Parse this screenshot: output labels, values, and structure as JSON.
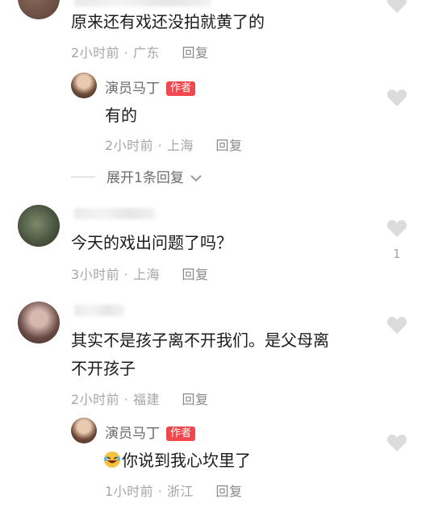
{
  "comments": [
    {
      "text": "原来还有戏还没拍就黄了的",
      "time": "2小时前 · 广东",
      "reply_label": "回复"
    },
    {
      "text": "今天的戏出问题了吗？",
      "time": "3小时前 · 上海",
      "reply_label": "回复",
      "like_count": "1"
    },
    {
      "text_line1": "其实不是孩子离不开我们。是父母离",
      "text_line2": "不开孩子",
      "time": "2小时前 · 福建",
      "reply_label": "回复"
    }
  ],
  "replies": [
    {
      "author": "演员马丁",
      "badge": "作者",
      "text": "有的",
      "time": "2小时前 · 上海",
      "reply_label": "回复"
    },
    {
      "author": "演员马丁",
      "badge": "作者",
      "text": "你说到我心坎里了",
      "time": "1小时前 · 浙江",
      "reply_label": "回复"
    }
  ],
  "expand_label": "展开1条回复",
  "colors": {
    "badge": "#f0484c",
    "meta": "#a6a6a6",
    "heart": "#dcdcdc"
  }
}
